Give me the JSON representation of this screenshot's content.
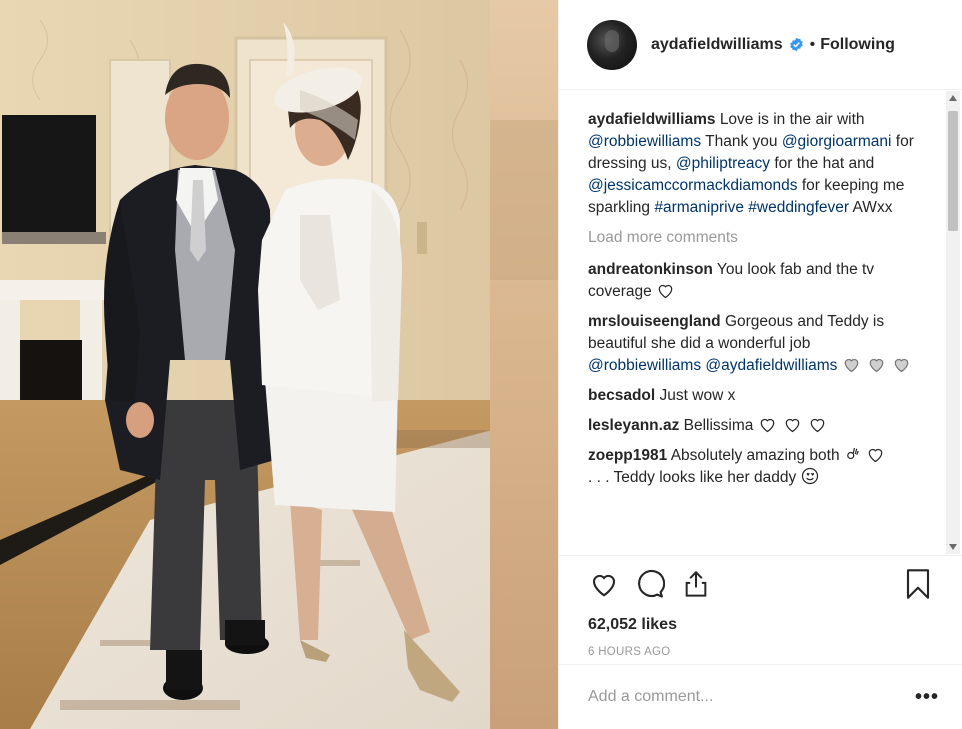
{
  "post": {
    "photo_icon": "post-photo",
    "avatar_icon": "avatar"
  },
  "header": {
    "username": "aydafieldwilliams",
    "verified_icon": "verified-badge-icon",
    "separator": "•",
    "follow_state": "Following"
  },
  "caption": {
    "username": "aydafieldwilliams",
    "text_1": "Love is in the air with",
    "mention_1": "@robbiewilliams",
    "text_2": "Thank you",
    "mention_2": "@giorgioarmani",
    "text_3": "for dressing us,",
    "mention_3": "@philiptreacy",
    "text_4": "for the hat and",
    "mention_4": "@jessicamccormackdiamonds",
    "text_5": "for keeping me sparkling",
    "hashtag_1": "#armaniprive",
    "hashtag_2": "#weddingfever",
    "text_6": "AWxx"
  },
  "load_more": "Load more comments",
  "comments": [
    {
      "username": "andreatonkinson",
      "text": "You look fab and the tv coverage"
    },
    {
      "username": "mrslouiseengland",
      "text": "Gorgeous and Teddy is beautiful she did a wonderful job",
      "mention_1": "@robbiewilliams",
      "mention_2": "@aydafieldwilliams"
    },
    {
      "username": "becsadol",
      "text": "Just wow x"
    },
    {
      "username": "lesleyann.az",
      "text": "Bellissima"
    },
    {
      "username": "zoepp1981",
      "text": "Absolutely amazing both",
      "text_2": ". . . Teddy looks like her daddy"
    }
  ],
  "actions": {
    "like_icon": "heart-icon",
    "comment_icon": "comment-icon",
    "share_icon": "share-icon",
    "save_icon": "bookmark-icon"
  },
  "likes": "62,052 likes",
  "timestamp": "6 HOURS AGO",
  "add_comment": {
    "placeholder": "Add a comment..."
  },
  "more_label": "•••",
  "colors": {
    "link": "#003569",
    "muted": "#999999",
    "text": "#262626",
    "verified": "#3897f0"
  }
}
